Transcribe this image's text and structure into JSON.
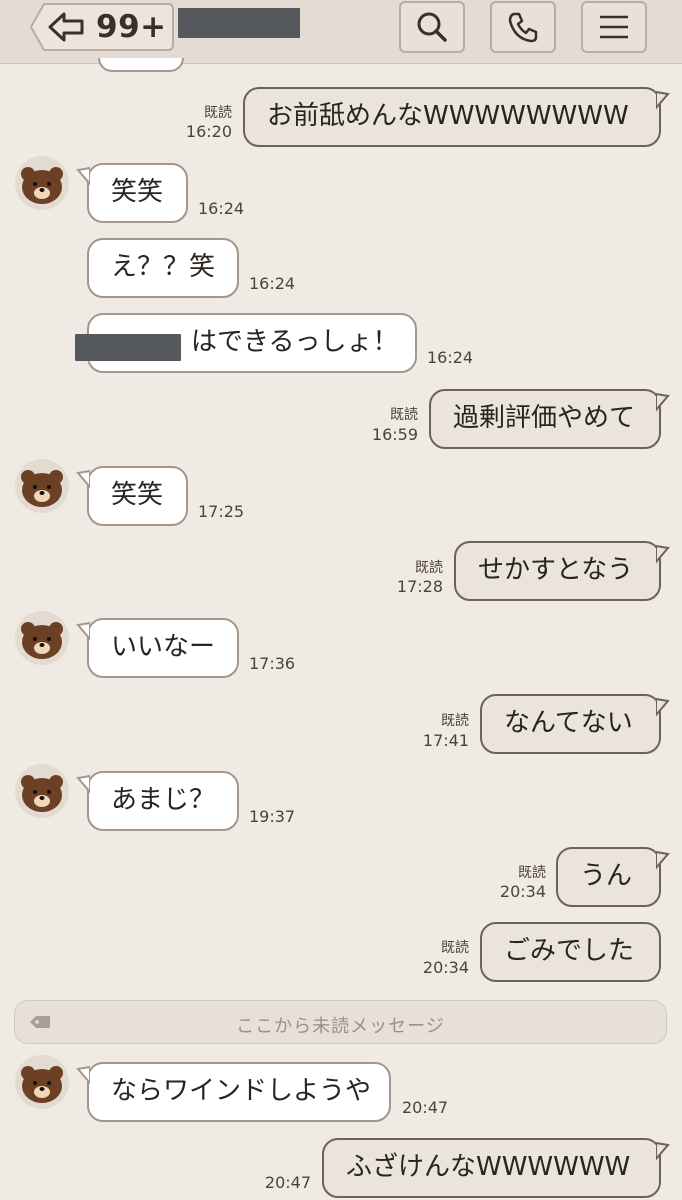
{
  "header": {
    "back_count": "99+",
    "icons": [
      "back-arrow-icon",
      "search-icon",
      "phone-icon",
      "menu-icon"
    ]
  },
  "messages": [
    {
      "side": "out",
      "text": "お前舐めんなWWWWWWWW",
      "read": "既読",
      "time": "16:20"
    },
    {
      "side": "in",
      "text": "笑笑",
      "time": "16:24"
    },
    {
      "side": "in",
      "text": "え？？笑",
      "time": "16:24"
    },
    {
      "side": "in",
      "text": "はできるっしょ！",
      "time": "16:24"
    },
    {
      "side": "out",
      "text": "過剰評価やめて",
      "read": "既読",
      "time": "16:59"
    },
    {
      "side": "in",
      "text": "笑笑",
      "time": "17:25"
    },
    {
      "side": "out",
      "text": "せかすとなう",
      "read": "既読",
      "time": "17:28"
    },
    {
      "side": "in",
      "text": "いいなー",
      "time": "17:36"
    },
    {
      "side": "out",
      "text": "なんてない",
      "read": "既読",
      "time": "17:41"
    },
    {
      "side": "in",
      "text": "あまじ？",
      "time": "19:37"
    },
    {
      "side": "out",
      "text": "うん",
      "read": "既読",
      "time": "20:34"
    },
    {
      "side": "out",
      "text": "ごみでした",
      "read": "既読",
      "time": "20:34"
    },
    {
      "side": "in",
      "text": "ならワインドしようや",
      "time": "20:47"
    },
    {
      "side": "out",
      "text": "ふざけんなWWWWWW",
      "time": "20:47"
    }
  ],
  "unread_divider": "ここから未読メッセージ",
  "colors": {
    "background": "#efeae4",
    "header": "#e4dbd2",
    "bubble_in": "#ffffff",
    "bubble_out": "#ebe4dc",
    "bubble_border": "#a4968b"
  }
}
